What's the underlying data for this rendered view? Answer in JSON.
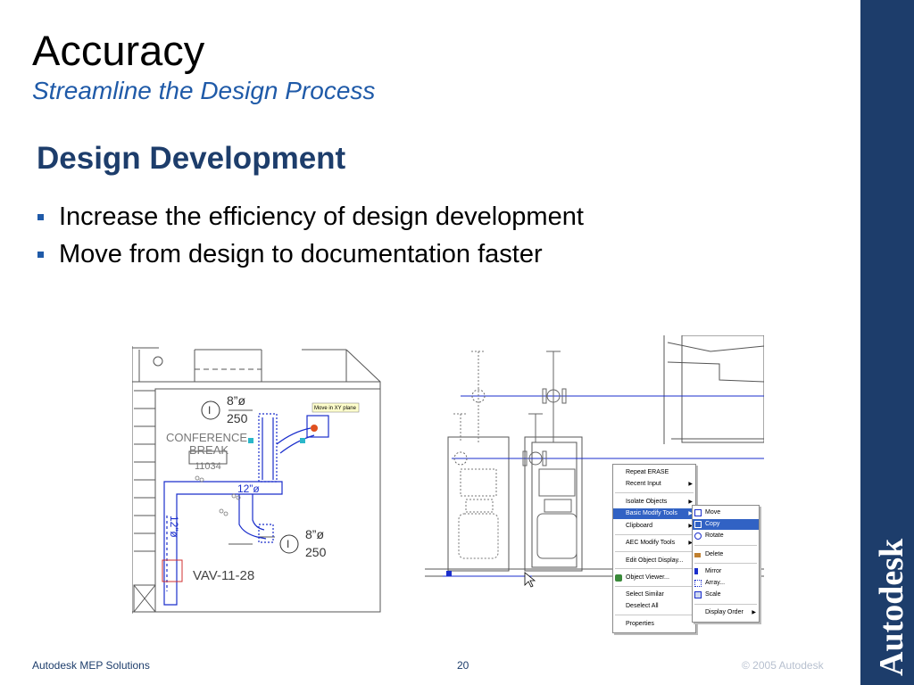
{
  "slide": {
    "title": "Accuracy",
    "subtitle": "Streamline the Design Process",
    "section_heading": "Design Development",
    "bullets": [
      "Increase the efficiency of design development",
      "Move from design to documentation faster"
    ]
  },
  "plan_drawing": {
    "tag_1": "I",
    "size_1": "8”ø",
    "cfm_1": "250",
    "room_name_1": "CONFERENCE",
    "room_name_2": "BREAK",
    "room_number": "11034",
    "duct_size_1": "12”ø",
    "duct_size_2": "12”ø",
    "tag_2": "I",
    "size_2": "8”ø",
    "cfm_2": "250",
    "equipment": "VAV-11-28",
    "tooltip": "Move in XY plane"
  },
  "context_menu": {
    "items": [
      "Repeat ERASE",
      "Recent Input",
      "Isolate Objects",
      "Basic Modify Tools",
      "Clipboard",
      "AEC Modify Tools",
      "Edit Object Display...",
      "Object Viewer...",
      "Select Similar",
      "Deselect All",
      "Properties"
    ],
    "submenu": [
      "Move",
      "Copy",
      "Rotate",
      "Delete",
      "Mirror",
      "Array...",
      "Scale",
      "Display Order"
    ]
  },
  "brand": {
    "logo_text": "Autodesk",
    "sidebar_color": "#1d3d6b"
  },
  "footer": {
    "left": "Autodesk MEP Solutions",
    "page_number": "20",
    "copyright": "© 2005 Autodesk"
  },
  "colors": {
    "title_blue": "#1f5aa8",
    "heading_navy": "#1d3d6b",
    "menu_highlight": "#3162c4",
    "cad_blue": "#1a2ecc"
  }
}
